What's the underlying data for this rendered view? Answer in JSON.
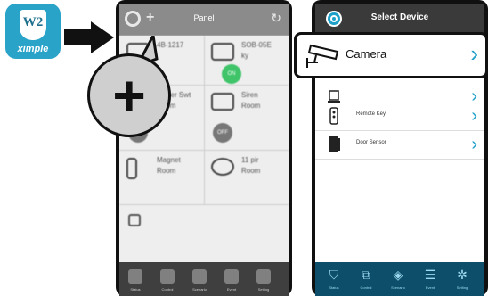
{
  "logo": {
    "mark": "W2",
    "brand": "ximple"
  },
  "phone1": {
    "header_title": "Panel",
    "cells": [
      {
        "name": "4B-1217",
        "room": "",
        "status": ""
      },
      {
        "name": "SOB-05E",
        "room": "ky",
        "status": "ON"
      },
      {
        "name": "Power Swt",
        "room": "Room",
        "status": "OFF"
      },
      {
        "name": "Siren",
        "room": "Room",
        "status": "OFF"
      },
      {
        "name": "Magnet",
        "room": "Room",
        "status": ""
      },
      {
        "name": "11 pir",
        "room": "Room",
        "status": ""
      }
    ],
    "tabs": [
      "Status",
      "Control",
      "Scenario",
      "Event",
      "Setting"
    ]
  },
  "zoom": {
    "glyph": "+"
  },
  "phone2": {
    "header_title": "Select Device",
    "highlight_item": {
      "label": "Camera",
      "icon": "camera-icon"
    },
    "items": [
      {
        "label": "",
        "icon": "siren-icon"
      },
      {
        "label": "Remote Key",
        "icon": "remote-key-icon"
      },
      {
        "label": "Door Sensor",
        "icon": "door-sensor-icon"
      }
    ],
    "tabs": [
      "Status",
      "Control",
      "Scenario",
      "Event",
      "Setting"
    ],
    "accent": "#1fa0c8",
    "tabbar_color": "#0d4f6a"
  }
}
